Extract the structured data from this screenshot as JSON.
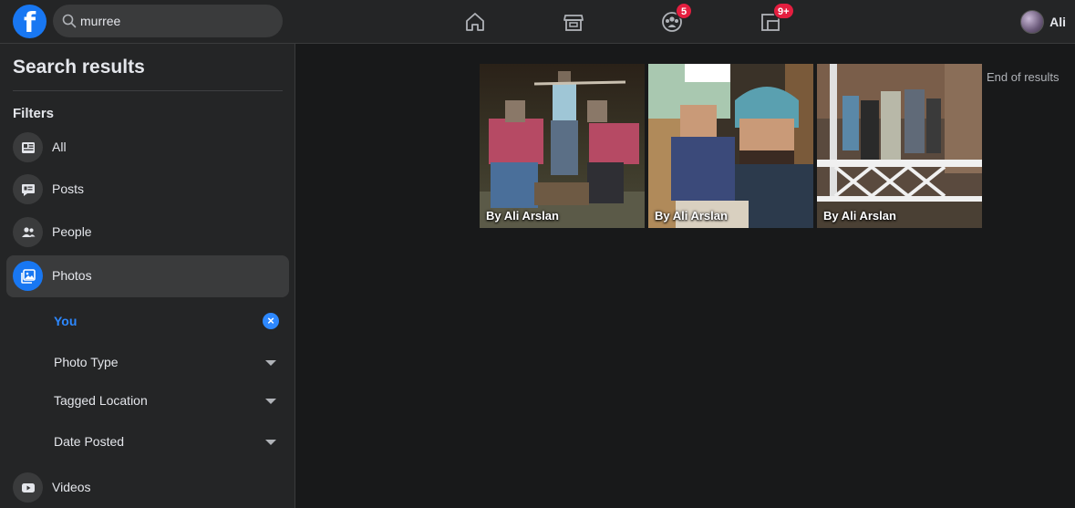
{
  "header": {
    "logo": "f",
    "search": {
      "value": "murree",
      "placeholder": "Search Facebook"
    },
    "nav": [
      {
        "name": "home",
        "badge": ""
      },
      {
        "name": "marketplace",
        "badge": ""
      },
      {
        "name": "groups",
        "badge": "5"
      },
      {
        "name": "gaming",
        "badge": "9+"
      }
    ],
    "profile": {
      "name": "Ali"
    }
  },
  "sidebar": {
    "title": "Search results",
    "filters_label": "Filters",
    "items": [
      {
        "label": "All",
        "icon": "newspaper-icon"
      },
      {
        "label": "Posts",
        "icon": "posts-icon"
      },
      {
        "label": "People",
        "icon": "people-icon"
      },
      {
        "label": "Photos",
        "icon": "photos-icon",
        "active": true
      },
      {
        "label": "Videos",
        "icon": "video-icon"
      }
    ],
    "photo_filters": [
      {
        "label": "You",
        "selected": true
      },
      {
        "label": "Photo Type"
      },
      {
        "label": "Tagged Location"
      },
      {
        "label": "Date Posted"
      }
    ]
  },
  "results": {
    "photos": [
      {
        "caption": "By Ali Arslan"
      },
      {
        "caption": "By Ali Arslan"
      },
      {
        "caption": "By Ali Arslan"
      }
    ],
    "end_text": "End of results"
  },
  "colors": {
    "accent": "#1877f2",
    "link": "#2d88ff",
    "badge": "#e41e3f",
    "surface": "#242526",
    "background": "#18191a"
  }
}
